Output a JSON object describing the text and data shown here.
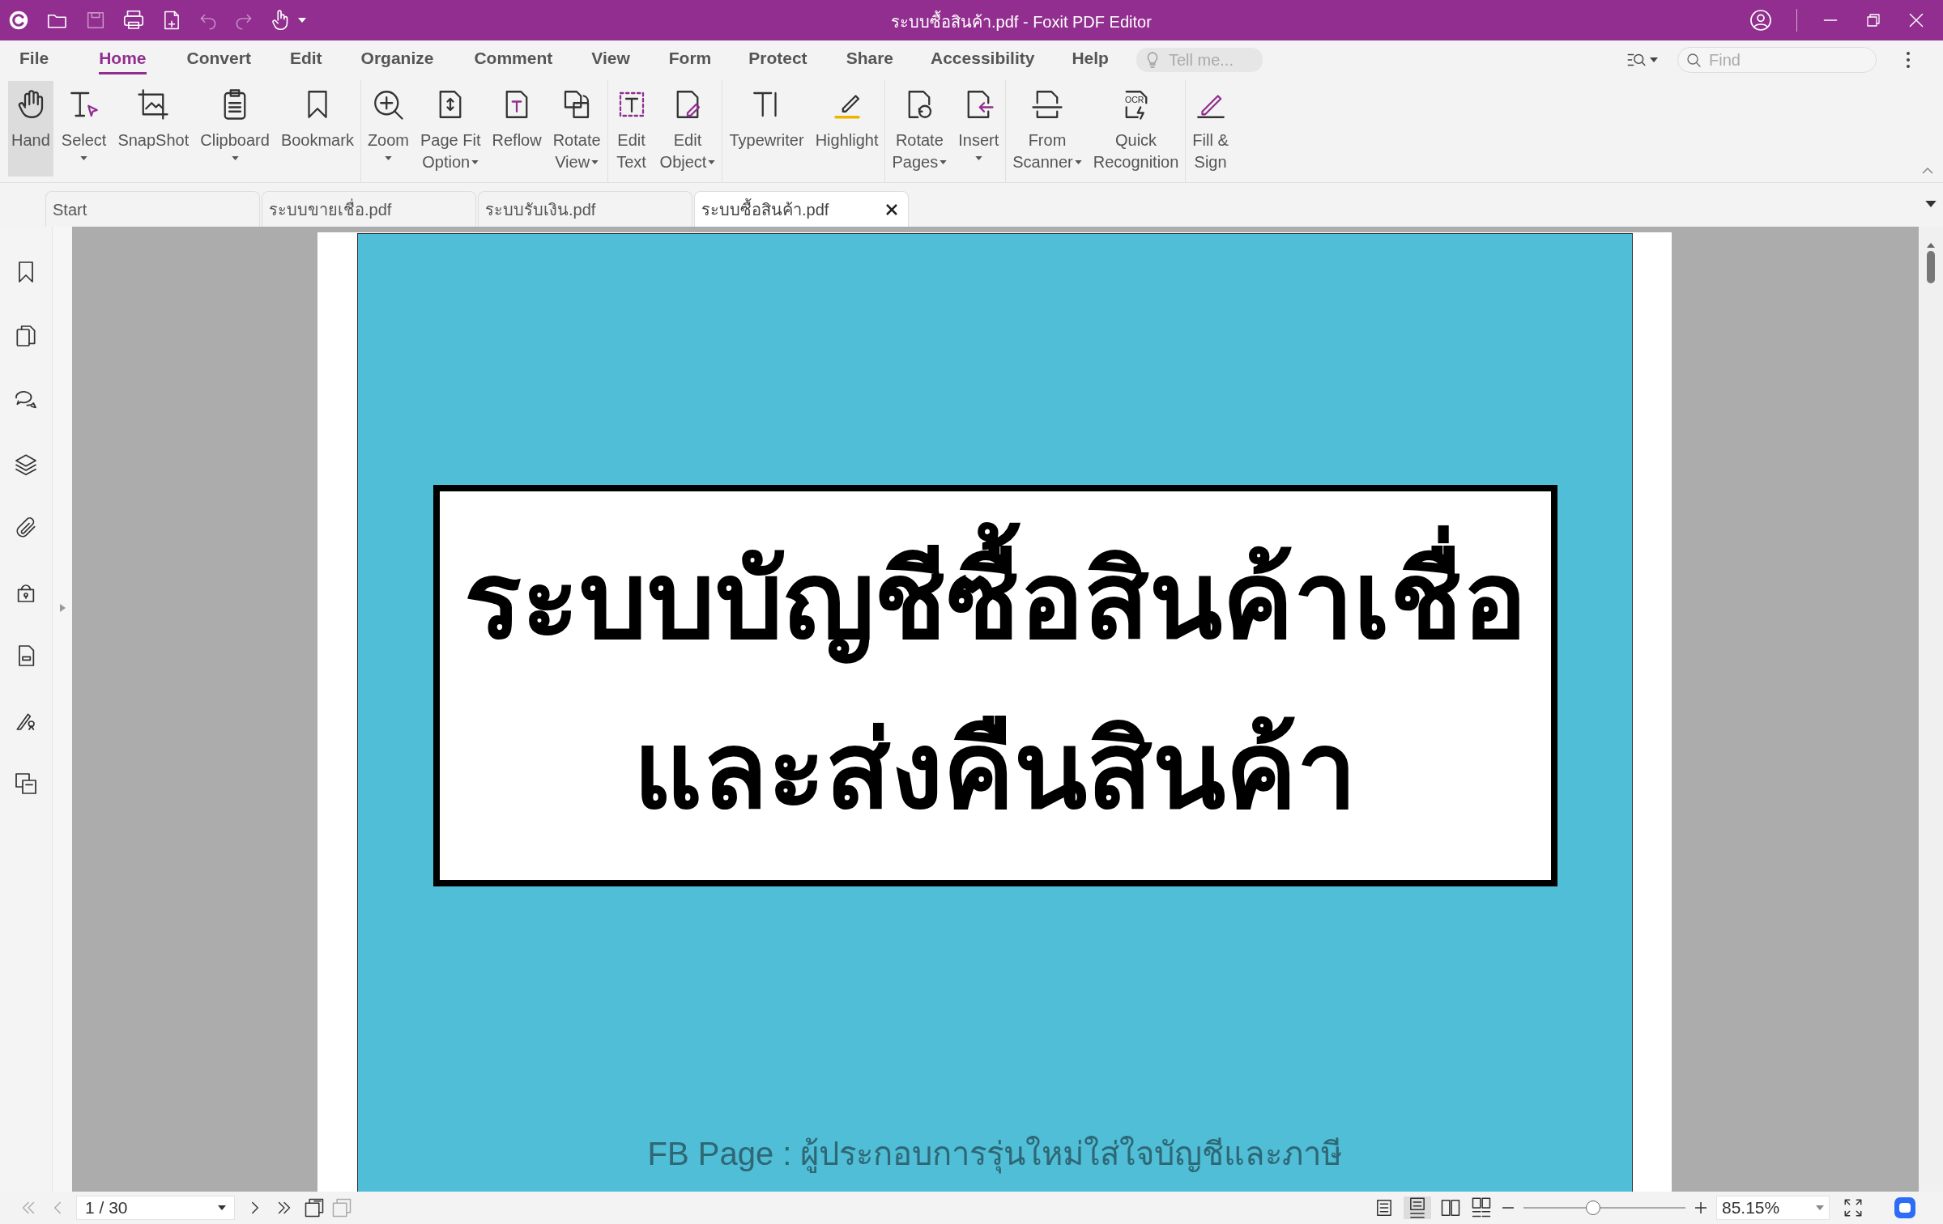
{
  "title_bar": {
    "title": "ระบบซื้อสินค้า.pdf - Foxit PDF Editor"
  },
  "menu_tabs": [
    {
      "label": "File",
      "selected": false
    },
    {
      "label": "Home",
      "selected": true
    },
    {
      "label": "Convert",
      "selected": false
    },
    {
      "label": "Edit",
      "selected": false
    },
    {
      "label": "Organize",
      "selected": false
    },
    {
      "label": "Comment",
      "selected": false
    },
    {
      "label": "View",
      "selected": false
    },
    {
      "label": "Form",
      "selected": false
    },
    {
      "label": "Protect",
      "selected": false
    },
    {
      "label": "Share",
      "selected": false
    },
    {
      "label": "Accessibility",
      "selected": false
    },
    {
      "label": "Help",
      "selected": false
    }
  ],
  "tell_me": {
    "placeholder": "Tell me..."
  },
  "find": {
    "placeholder": "Find"
  },
  "ribbon_groups": [
    [
      {
        "lines": [
          "Hand"
        ],
        "dropdown": false,
        "selected": true
      },
      {
        "lines": [
          "Select"
        ],
        "dropdown": true,
        "selected": false
      },
      {
        "lines": [
          "SnapShot"
        ],
        "dropdown": false,
        "selected": false
      },
      {
        "lines": [
          "Clipboard"
        ],
        "dropdown": true,
        "selected": false
      },
      {
        "lines": [
          "Bookmark"
        ],
        "dropdown": false,
        "selected": false
      }
    ],
    [
      {
        "lines": [
          "Zoom"
        ],
        "dropdown": true,
        "selected": false
      },
      {
        "lines": [
          "Page Fit",
          "Option"
        ],
        "dropdown": true,
        "selected": false
      },
      {
        "lines": [
          "Reflow"
        ],
        "dropdown": false,
        "selected": false
      },
      {
        "lines": [
          "Rotate",
          "View"
        ],
        "dropdown": true,
        "selected": false
      }
    ],
    [
      {
        "lines": [
          "Edit",
          "Text"
        ],
        "dropdown": false,
        "selected": false
      },
      {
        "lines": [
          "Edit",
          "Object"
        ],
        "dropdown": true,
        "selected": false
      }
    ],
    [
      {
        "lines": [
          "Typewriter"
        ],
        "dropdown": false,
        "selected": false
      },
      {
        "lines": [
          "Highlight"
        ],
        "dropdown": false,
        "selected": false
      }
    ],
    [
      {
        "lines": [
          "Rotate",
          "Pages"
        ],
        "dropdown": true,
        "selected": false
      },
      {
        "lines": [
          "Insert"
        ],
        "dropdown": true,
        "selected": false
      }
    ],
    [
      {
        "lines": [
          "From",
          "Scanner"
        ],
        "dropdown": true,
        "selected": false
      },
      {
        "lines": [
          "Quick",
          "Recognition"
        ],
        "dropdown": false,
        "selected": false,
        "icon_text": "OCR"
      }
    ],
    [
      {
        "lines": [
          "Fill &",
          "Sign"
        ],
        "dropdown": false,
        "selected": false
      }
    ]
  ],
  "doc_tabs": [
    {
      "label": "Start",
      "selected": false
    },
    {
      "label": "ระบบขายเชื่อ.pdf",
      "selected": false
    },
    {
      "label": "ระบบรับเงิน.pdf",
      "selected": false
    },
    {
      "label": "ระบบซื้อสินค้า.pdf",
      "selected": true
    }
  ],
  "document": {
    "heading_lines": [
      "ระบบบัญชีซื้อสินค้าเชื่อ",
      "และส่งคืนสินค้า"
    ],
    "footer": "FB Page : ผู้ประกอบการรุ่นใหม่ใส่ใจบัญชีและภาษี"
  },
  "status_bar": {
    "page": "1 / 30",
    "zoom": "85.15%",
    "zoom_slider": {
      "level": 0.43
    }
  }
}
